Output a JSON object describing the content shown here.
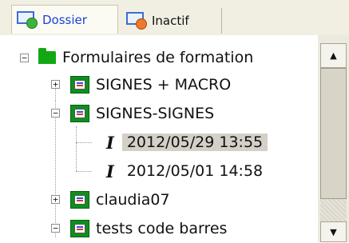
{
  "tabs": [
    {
      "label": "Dossier",
      "active": true,
      "icon": "monitor-green-icon"
    },
    {
      "label": "Inactif",
      "active": false,
      "icon": "monitor-orange-icon"
    }
  ],
  "tree": {
    "root": {
      "label": "Formulaires de formation",
      "expander": "−",
      "icon": "folder-icon"
    },
    "items": [
      {
        "label": "SIGNES + MACRO",
        "expander": "+",
        "icon": "form-icon"
      },
      {
        "label": "SIGNES-SIGNES",
        "expander": "−",
        "icon": "form-icon",
        "children": [
          {
            "label": "2012/05/29 13:55",
            "icon": "italic-i-icon",
            "selected": true
          },
          {
            "label": "2012/05/01 14:58",
            "icon": "italic-i-icon",
            "selected": false
          }
        ]
      },
      {
        "label": "claudia07",
        "expander": "+",
        "icon": "form-icon"
      },
      {
        "label": "tests code barres",
        "expander": "−",
        "icon": "form-icon"
      }
    ]
  },
  "scrollbar": {
    "up_arrow": "▲",
    "down_arrow": "▼"
  },
  "colors": {
    "tab_active_text": "#1a44d8",
    "selection_bg": "#d4d0c8",
    "node_green": "#0e8f1e"
  }
}
